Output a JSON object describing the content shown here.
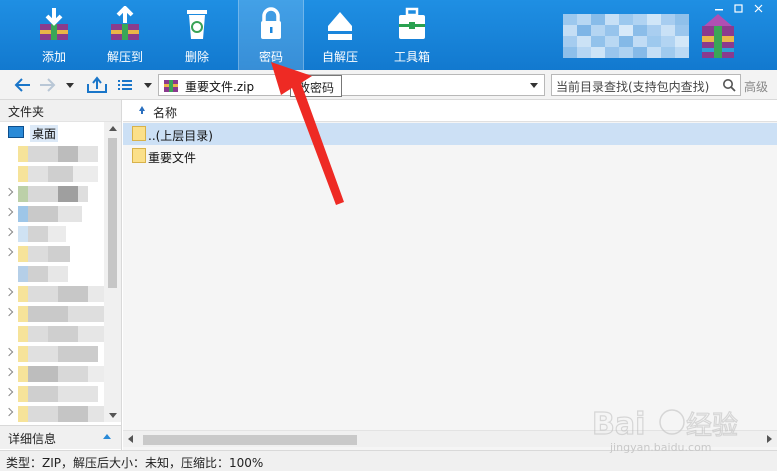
{
  "toolbar": {
    "add": "添加",
    "extract": "解压到",
    "delete": "删除",
    "password": "密码",
    "sfx": "自解压",
    "tools": "工具箱"
  },
  "address": {
    "path": "重要文件.zip",
    "tooltip": "改密码",
    "search_placeholder": "当前目录查找(支持包内查找)",
    "advanced": "高级"
  },
  "sidebar": {
    "header": "文件夹",
    "desktop": "桌面",
    "details": "详细信息"
  },
  "filelist": {
    "column_name": "名称",
    "rows": [
      {
        "label": "..(上层目录)"
      },
      {
        "label": "重要文件"
      }
    ]
  },
  "status": "类型：ZIP，解压后大小：未知，压缩比：100%",
  "watermark": {
    "logo": "Baidu经验",
    "url": "jingyan.baidu.com"
  },
  "colors": {
    "toolbar": "#1a86dc",
    "selection": "#cce0f5",
    "arrow": "#ee2a24"
  }
}
